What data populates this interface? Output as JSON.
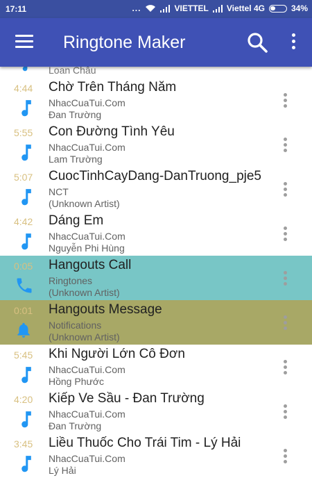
{
  "status_bar": {
    "time": "17:11",
    "dots": "...",
    "carrier1": "VIETTEL",
    "carrier2": "Viettel 4G",
    "battery": "34%",
    "battery_level": 0.34
  },
  "app_bar": {
    "title": "Ringtone Maker",
    "menu_icon": "hamburger-menu-icon",
    "search_icon": "search-icon",
    "more_icon": "more-vert-icon"
  },
  "colors": {
    "primary": "#3f51b5",
    "status_bar": "#3a4fa0",
    "icon_blue": "#2196f3",
    "duration": "#d8c081",
    "call_highlight": "#78c6c6",
    "notification_highlight": "#a8a866"
  },
  "list": {
    "partial_top": {
      "artist": "Loan Châu"
    },
    "items": [
      {
        "duration": "4:44",
        "title": "Chờ Trên Tháng Năm",
        "album": "NhacCuaTui.Com",
        "artist": "Đan Trường",
        "icon": "music-note-icon",
        "bg": "#ffffff"
      },
      {
        "duration": "5:55",
        "title": "Con Đường Tình Yêu",
        "album": "NhacCuaTui.Com",
        "artist": "Lam Trường",
        "icon": "music-note-icon",
        "bg": "#ffffff"
      },
      {
        "duration": "5:07",
        "title": "CuocTinhCayDang-DanTruong_pje5",
        "album": "NCT",
        "artist": "(Unknown Artist)",
        "icon": "music-note-icon",
        "bg": "#ffffff"
      },
      {
        "duration": "4:42",
        "title": "Dáng Em",
        "album": "NhacCuaTui.Com",
        "artist": "Nguyễn Phi Hùng",
        "icon": "music-note-icon",
        "bg": "#ffffff"
      },
      {
        "duration": "0:05",
        "title": "Hangouts Call",
        "album": "Ringtones",
        "artist": "(Unknown Artist)",
        "icon": "phone-icon",
        "bg": "#78c6c6"
      },
      {
        "duration": "0:01",
        "title": "Hangouts Message",
        "album": "Notifications",
        "artist": "(Unknown Artist)",
        "icon": "bell-icon",
        "bg": "#a8a866"
      },
      {
        "duration": "5:45",
        "title": "Khi Người Lớn Cô Đơn",
        "album": "NhacCuaTui.Com",
        "artist": "Hồng Phước",
        "icon": "music-note-icon",
        "bg": "#ffffff"
      },
      {
        "duration": "4:20",
        "title": "Kiếp Ve Sầu - Đan Trường",
        "album": "NhacCuaTui.Com",
        "artist": "Đan Trường",
        "icon": "music-note-icon",
        "bg": "#ffffff"
      },
      {
        "duration": "3:45",
        "title": "Liều Thuốc Cho Trái Tim - Lý Hải",
        "album": "NhacCuaTui.Com",
        "artist": "Lý Hải",
        "icon": "music-note-icon",
        "bg": "#ffffff"
      }
    ]
  }
}
